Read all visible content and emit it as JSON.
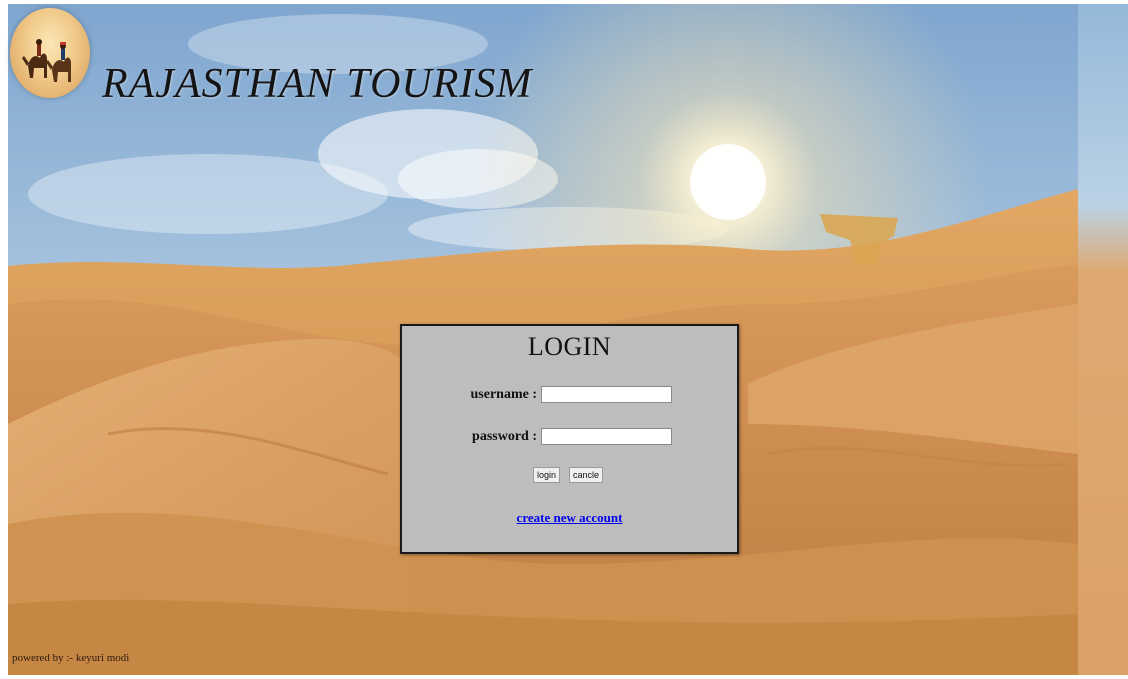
{
  "header": {
    "site_title": "RAJASTHAN TOURISM",
    "logo_icon": "camel-riders-icon"
  },
  "login": {
    "title": "LOGIN",
    "username_label": "username :",
    "username_value": "",
    "password_label": "password :",
    "password_value": "",
    "login_button": "login",
    "cancel_button": "cancle",
    "create_account_link": "create new account"
  },
  "footer": {
    "credit": "powered by :- keyuri modi"
  },
  "colors": {
    "sky": "#8fb8dd",
    "sand": "#d99a5b",
    "box_bg": "#bdbdbd",
    "link": "#0000ee"
  }
}
